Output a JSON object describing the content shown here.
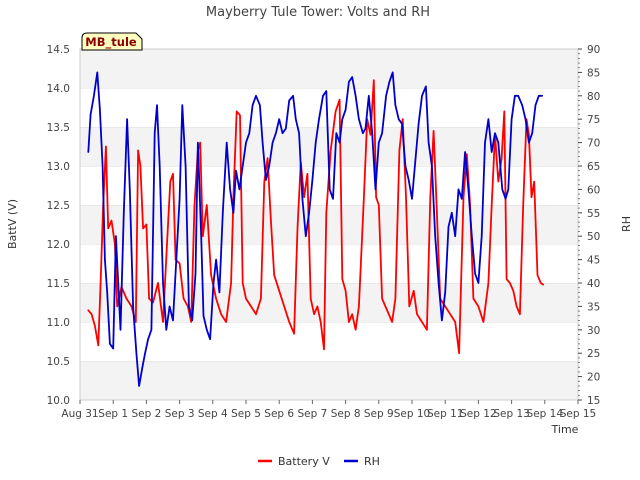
{
  "chart_data": {
    "type": "line",
    "title": "Mayberry Tule Tower: Volts and RH",
    "site_label": "MB_tule",
    "xlabel": "Time",
    "ylabel_left": "BattV (V)",
    "ylabel_right": "RH",
    "xlim": [
      0,
      15
    ],
    "ylim_left": [
      10.0,
      14.5
    ],
    "ylim_right": [
      15,
      90
    ],
    "x_ticks": [
      {
        "pos": 0,
        "label": "Aug 31"
      },
      {
        "pos": 1,
        "label": "Sep 1"
      },
      {
        "pos": 2,
        "label": "Sep 2"
      },
      {
        "pos": 3,
        "label": "Sep 3"
      },
      {
        "pos": 4,
        "label": "Sep 4"
      },
      {
        "pos": 5,
        "label": "Sep 5"
      },
      {
        "pos": 6,
        "label": "Sep 6"
      },
      {
        "pos": 7,
        "label": "Sep 7"
      },
      {
        "pos": 8,
        "label": "Sep 8"
      },
      {
        "pos": 9,
        "label": "Sep 9"
      },
      {
        "pos": 10,
        "label": "Sep 10"
      },
      {
        "pos": 11,
        "label": "Sep 11"
      },
      {
        "pos": 12,
        "label": "Sep 12"
      },
      {
        "pos": 13,
        "label": "Sep 13"
      },
      {
        "pos": 14,
        "label": "Sep 14"
      },
      {
        "pos": 15,
        "label": "Sep 15"
      }
    ],
    "y_ticks_left": [
      "10.0",
      "10.5",
      "11.0",
      "11.5",
      "12.0",
      "12.5",
      "13.0",
      "13.5",
      "14.0",
      "14.5"
    ],
    "y_ticks_right": [
      "15",
      "20",
      "25",
      "30",
      "35",
      "40",
      "45",
      "50",
      "55",
      "60",
      "65",
      "70",
      "75",
      "80",
      "85",
      "90"
    ],
    "grid": "horizontal bands",
    "legend_position": "bottom-center",
    "series": [
      {
        "name": "Battery V",
        "axis": "left",
        "color": "#ff0000",
        "points": [
          [
            0.25,
            11.15
          ],
          [
            0.35,
            11.1
          ],
          [
            0.45,
            10.95
          ],
          [
            0.55,
            10.7
          ],
          [
            0.62,
            11.5
          ],
          [
            0.7,
            12.5
          ],
          [
            0.78,
            13.25
          ],
          [
            0.85,
            12.2
          ],
          [
            0.95,
            12.3
          ],
          [
            1.05,
            12.0
          ],
          [
            1.12,
            11.2
          ],
          [
            1.25,
            11.45
          ],
          [
            1.4,
            11.3
          ],
          [
            1.55,
            11.2
          ],
          [
            1.68,
            11.0
          ],
          [
            1.75,
            13.2
          ],
          [
            1.82,
            13.0
          ],
          [
            1.9,
            12.2
          ],
          [
            2.0,
            12.25
          ],
          [
            2.08,
            11.3
          ],
          [
            2.2,
            11.25
          ],
          [
            2.35,
            11.5
          ],
          [
            2.5,
            11.0
          ],
          [
            2.62,
            12.0
          ],
          [
            2.72,
            12.8
          ],
          [
            2.8,
            12.9
          ],
          [
            2.88,
            11.8
          ],
          [
            3.0,
            11.75
          ],
          [
            3.12,
            11.3
          ],
          [
            3.25,
            11.2
          ],
          [
            3.35,
            11.0
          ],
          [
            3.45,
            12.5
          ],
          [
            3.55,
            13.2
          ],
          [
            3.62,
            13.3
          ],
          [
            3.7,
            12.1
          ],
          [
            3.82,
            12.5
          ],
          [
            3.95,
            11.6
          ],
          [
            4.1,
            11.3
          ],
          [
            4.25,
            11.1
          ],
          [
            4.4,
            11.0
          ],
          [
            4.55,
            11.5
          ],
          [
            4.62,
            12.6
          ],
          [
            4.72,
            13.7
          ],
          [
            4.82,
            13.65
          ],
          [
            4.9,
            11.5
          ],
          [
            5.0,
            11.3
          ],
          [
            5.15,
            11.2
          ],
          [
            5.3,
            11.1
          ],
          [
            5.45,
            11.3
          ],
          [
            5.55,
            12.8
          ],
          [
            5.65,
            13.1
          ],
          [
            5.75,
            12.3
          ],
          [
            5.85,
            11.6
          ],
          [
            6.0,
            11.4
          ],
          [
            6.15,
            11.2
          ],
          [
            6.3,
            11.0
          ],
          [
            6.45,
            10.85
          ],
          [
            6.55,
            12.2
          ],
          [
            6.65,
            13.05
          ],
          [
            6.75,
            12.6
          ],
          [
            6.85,
            12.9
          ],
          [
            6.95,
            11.3
          ],
          [
            7.05,
            11.1
          ],
          [
            7.15,
            11.2
          ],
          [
            7.25,
            11.0
          ],
          [
            7.35,
            10.65
          ],
          [
            7.42,
            12.4
          ],
          [
            7.55,
            13.2
          ],
          [
            7.7,
            13.7
          ],
          [
            7.82,
            13.85
          ],
          [
            7.9,
            11.55
          ],
          [
            8.0,
            11.4
          ],
          [
            8.1,
            11.0
          ],
          [
            8.2,
            11.1
          ],
          [
            8.3,
            10.9
          ],
          [
            8.4,
            11.2
          ],
          [
            8.55,
            12.6
          ],
          [
            8.65,
            13.6
          ],
          [
            8.75,
            13.4
          ],
          [
            8.85,
            14.1
          ],
          [
            8.92,
            12.6
          ],
          [
            9.0,
            12.5
          ],
          [
            9.1,
            11.3
          ],
          [
            9.2,
            11.2
          ],
          [
            9.3,
            11.1
          ],
          [
            9.4,
            11.0
          ],
          [
            9.5,
            11.3
          ],
          [
            9.62,
            13.2
          ],
          [
            9.72,
            13.6
          ],
          [
            9.82,
            12.6
          ],
          [
            9.92,
            11.2
          ],
          [
            10.05,
            11.4
          ],
          [
            10.15,
            11.1
          ],
          [
            10.3,
            11.0
          ],
          [
            10.45,
            10.9
          ],
          [
            10.55,
            12.6
          ],
          [
            10.65,
            13.45
          ],
          [
            10.75,
            12.4
          ],
          [
            10.85,
            11.3
          ],
          [
            11.0,
            11.2
          ],
          [
            11.15,
            11.1
          ],
          [
            11.3,
            11.0
          ],
          [
            11.42,
            10.6
          ],
          [
            11.55,
            12.6
          ],
          [
            11.65,
            13.15
          ],
          [
            11.75,
            12.5
          ],
          [
            11.85,
            11.3
          ],
          [
            12.0,
            11.2
          ],
          [
            12.15,
            11.0
          ],
          [
            12.3,
            11.5
          ],
          [
            12.4,
            12.5
          ],
          [
            12.5,
            13.4
          ],
          [
            12.6,
            12.8
          ],
          [
            12.7,
            13.1
          ],
          [
            12.78,
            13.7
          ],
          [
            12.85,
            11.55
          ],
          [
            12.95,
            11.5
          ],
          [
            13.05,
            11.4
          ],
          [
            13.15,
            11.2
          ],
          [
            13.25,
            11.1
          ],
          [
            13.35,
            12.5
          ],
          [
            13.45,
            13.6
          ],
          [
            13.52,
            13.4
          ],
          [
            13.6,
            12.6
          ],
          [
            13.68,
            12.8
          ],
          [
            13.78,
            11.6
          ],
          [
            13.88,
            11.5
          ],
          [
            13.95,
            11.48
          ]
        ]
      },
      {
        "name": "RH",
        "axis": "right",
        "color": "#0000cc",
        "points": [
          [
            0.25,
            68
          ],
          [
            0.32,
            76
          ],
          [
            0.42,
            80
          ],
          [
            0.52,
            85
          ],
          [
            0.6,
            77
          ],
          [
            0.68,
            65
          ],
          [
            0.75,
            45
          ],
          [
            0.82,
            38
          ],
          [
            0.9,
            27
          ],
          [
            1.0,
            26
          ],
          [
            1.08,
            50
          ],
          [
            1.15,
            40
          ],
          [
            1.22,
            30
          ],
          [
            1.32,
            55
          ],
          [
            1.42,
            75
          ],
          [
            1.5,
            60
          ],
          [
            1.6,
            35
          ],
          [
            1.7,
            25
          ],
          [
            1.78,
            18
          ],
          [
            1.88,
            22
          ],
          [
            1.96,
            25
          ],
          [
            2.05,
            28
          ],
          [
            2.15,
            30
          ],
          [
            2.25,
            72
          ],
          [
            2.32,
            78
          ],
          [
            2.4,
            65
          ],
          [
            2.5,
            40
          ],
          [
            2.6,
            30
          ],
          [
            2.7,
            35
          ],
          [
            2.8,
            32
          ],
          [
            2.9,
            45
          ],
          [
            3.0,
            58
          ],
          [
            3.08,
            78
          ],
          [
            3.18,
            65
          ],
          [
            3.28,
            35
          ],
          [
            3.38,
            32
          ],
          [
            3.48,
            42
          ],
          [
            3.55,
            70
          ],
          [
            3.65,
            50
          ],
          [
            3.72,
            33
          ],
          [
            3.82,
            30
          ],
          [
            3.92,
            28
          ],
          [
            4.02,
            40
          ],
          [
            4.1,
            45
          ],
          [
            4.2,
            38
          ],
          [
            4.3,
            55
          ],
          [
            4.42,
            70
          ],
          [
            4.52,
            60
          ],
          [
            4.62,
            55
          ],
          [
            4.7,
            64
          ],
          [
            4.8,
            60
          ],
          [
            4.9,
            65
          ],
          [
            5.0,
            70
          ],
          [
            5.1,
            72
          ],
          [
            5.2,
            78
          ],
          [
            5.3,
            80
          ],
          [
            5.42,
            78
          ],
          [
            5.5,
            70
          ],
          [
            5.6,
            62
          ],
          [
            5.7,
            65
          ],
          [
            5.8,
            70
          ],
          [
            5.9,
            72
          ],
          [
            6.0,
            75
          ],
          [
            6.1,
            72
          ],
          [
            6.2,
            73
          ],
          [
            6.3,
            79
          ],
          [
            6.42,
            80
          ],
          [
            6.5,
            75
          ],
          [
            6.6,
            72
          ],
          [
            6.7,
            58
          ],
          [
            6.8,
            50
          ],
          [
            6.9,
            55
          ],
          [
            7.0,
            62
          ],
          [
            7.1,
            70
          ],
          [
            7.2,
            75
          ],
          [
            7.32,
            80
          ],
          [
            7.42,
            81
          ],
          [
            7.52,
            60
          ],
          [
            7.62,
            58
          ],
          [
            7.72,
            72
          ],
          [
            7.82,
            70
          ],
          [
            7.9,
            75
          ],
          [
            8.0,
            77
          ],
          [
            8.1,
            83
          ],
          [
            8.2,
            84
          ],
          [
            8.3,
            80
          ],
          [
            8.4,
            75
          ],
          [
            8.52,
            72
          ],
          [
            8.6,
            73
          ],
          [
            8.7,
            80
          ],
          [
            8.8,
            72
          ],
          [
            8.9,
            60
          ],
          [
            9.0,
            70
          ],
          [
            9.1,
            72
          ],
          [
            9.22,
            80
          ],
          [
            9.32,
            83
          ],
          [
            9.42,
            85
          ],
          [
            9.5,
            78
          ],
          [
            9.6,
            75
          ],
          [
            9.7,
            74
          ],
          [
            9.8,
            65
          ],
          [
            9.9,
            62
          ],
          [
            10.0,
            58
          ],
          [
            10.1,
            66
          ],
          [
            10.2,
            74
          ],
          [
            10.3,
            80
          ],
          [
            10.42,
            82
          ],
          [
            10.5,
            70
          ],
          [
            10.6,
            65
          ],
          [
            10.7,
            50
          ],
          [
            10.8,
            40
          ],
          [
            10.9,
            32
          ],
          [
            11.0,
            38
          ],
          [
            11.1,
            52
          ],
          [
            11.2,
            55
          ],
          [
            11.3,
            50
          ],
          [
            11.4,
            60
          ],
          [
            11.5,
            58
          ],
          [
            11.6,
            68
          ],
          [
            11.7,
            60
          ],
          [
            11.8,
            50
          ],
          [
            11.9,
            42
          ],
          [
            12.0,
            40
          ],
          [
            12.1,
            50
          ],
          [
            12.2,
            70
          ],
          [
            12.3,
            75
          ],
          [
            12.4,
            68
          ],
          [
            12.5,
            72
          ],
          [
            12.6,
            70
          ],
          [
            12.72,
            60
          ],
          [
            12.82,
            58
          ],
          [
            12.9,
            60
          ],
          [
            13.0,
            75
          ],
          [
            13.1,
            80
          ],
          [
            13.2,
            80
          ],
          [
            13.32,
            78
          ],
          [
            13.42,
            75
          ],
          [
            13.52,
            70
          ],
          [
            13.62,
            72
          ],
          [
            13.72,
            78
          ],
          [
            13.82,
            80
          ],
          [
            13.92,
            80
          ]
        ]
      }
    ]
  },
  "legend": {
    "items": [
      {
        "label": "Battery V",
        "color": "#ff0000"
      },
      {
        "label": "RH",
        "color": "#0000cc"
      }
    ]
  }
}
